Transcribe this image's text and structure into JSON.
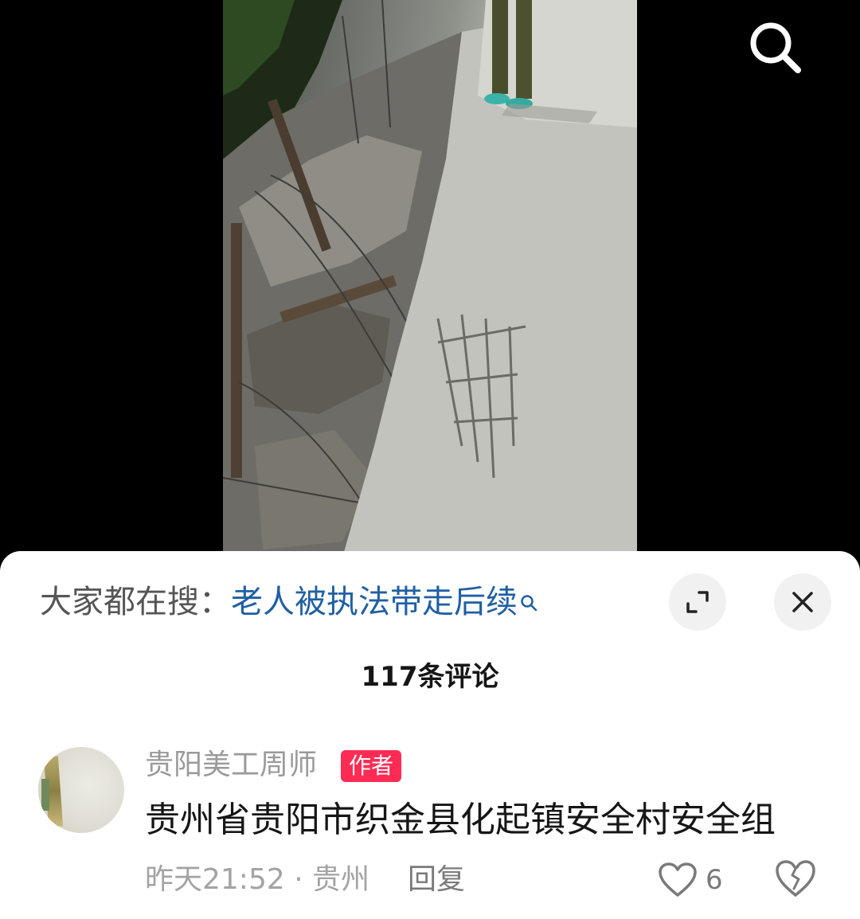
{
  "video": {
    "search_icon": "search-icon"
  },
  "hot_search": {
    "label": "大家都在搜：",
    "term": "老人被执法带走后续"
  },
  "sheet": {
    "comment_count": "117条评论",
    "expand_icon": "expand-icon",
    "close_icon": "close-icon"
  },
  "comment": {
    "username": "贵阳美工周师",
    "badge": "作者",
    "text": "贵州省贵阳市织金县化起镇安全村安全组",
    "time_location": "昨天21:52 · 贵州",
    "reply": "回复",
    "likes": "6",
    "like_icon": "heart-icon",
    "dislike_icon": "broken-heart-icon"
  },
  "colors": {
    "link": "#1f5fa3",
    "badge": "#fe2c55",
    "muted": "#a3a3a3"
  }
}
